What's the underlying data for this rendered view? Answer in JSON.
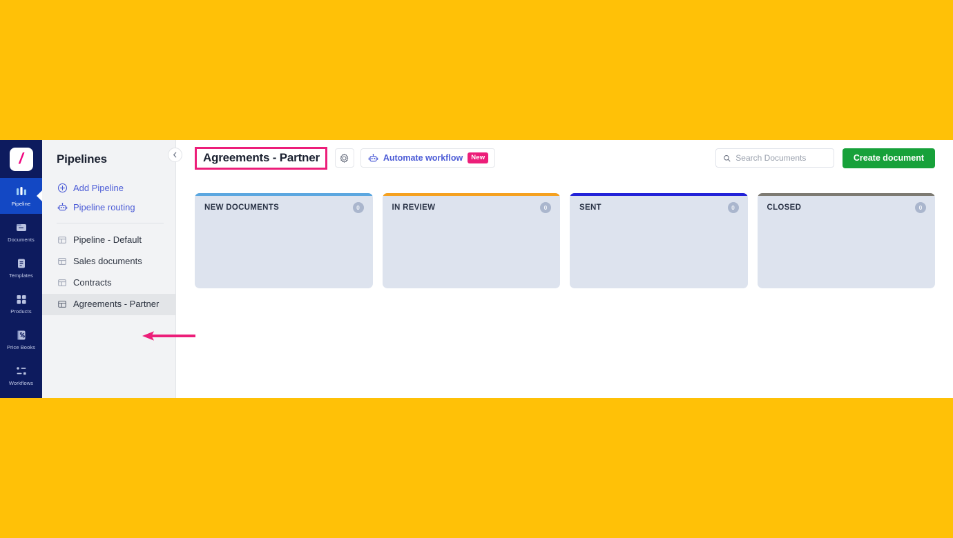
{
  "background_color": "#ffc107",
  "icon_rail": {
    "logo": {
      "name": "pandadoc-logo",
      "glyph": "/"
    },
    "items": [
      {
        "label": "Pipeline",
        "icon": "pipeline-icon",
        "active": true
      },
      {
        "label": "Documents",
        "icon": "documents-icon",
        "active": false
      },
      {
        "label": "Templates",
        "icon": "templates-icon",
        "active": false
      },
      {
        "label": "Products",
        "icon": "products-icon",
        "active": false
      },
      {
        "label": "Price Books",
        "icon": "price-books-icon",
        "active": false
      },
      {
        "label": "Workflows",
        "icon": "workflows-icon",
        "active": false
      }
    ]
  },
  "sidebar": {
    "title": "Pipelines",
    "actions": [
      {
        "label": "Add Pipeline",
        "icon": "plus-circle-icon"
      },
      {
        "label": "Pipeline routing",
        "icon": "robot-icon"
      }
    ],
    "pipelines": [
      {
        "label": "Pipeline - Default",
        "icon": "board-icon",
        "selected": false
      },
      {
        "label": "Sales documents",
        "icon": "board-icon",
        "selected": false
      },
      {
        "label": "Contracts",
        "icon": "board-icon",
        "selected": false
      },
      {
        "label": "Agreements - Partner",
        "icon": "board-icon",
        "selected": true
      }
    ],
    "collapse_icon": "chevron-left-icon"
  },
  "header": {
    "board_title": "Agreements - Partner",
    "highlight_color": "#ec1e79",
    "settings_icon": "gear-icon",
    "automate": {
      "label": "Automate workflow",
      "icon": "robot-icon",
      "badge": "New"
    },
    "search": {
      "placeholder": "Search Documents",
      "value": "",
      "icon": "search-icon"
    },
    "create_button": {
      "label": "Create document",
      "color": "#17a13a"
    }
  },
  "board": {
    "columns": [
      {
        "name": "NEW DOCUMENTS",
        "count": "0",
        "accent": "#5ba7e0"
      },
      {
        "name": "IN REVIEW",
        "count": "0",
        "accent": "#f5a120"
      },
      {
        "name": "SENT",
        "count": "0",
        "accent": "#2222d8"
      },
      {
        "name": "CLOSED",
        "count": "0",
        "accent": "#7d7a72"
      }
    ]
  },
  "annotation": {
    "arrow_color": "#ec1e79",
    "points_to": "Agreements - Partner"
  }
}
